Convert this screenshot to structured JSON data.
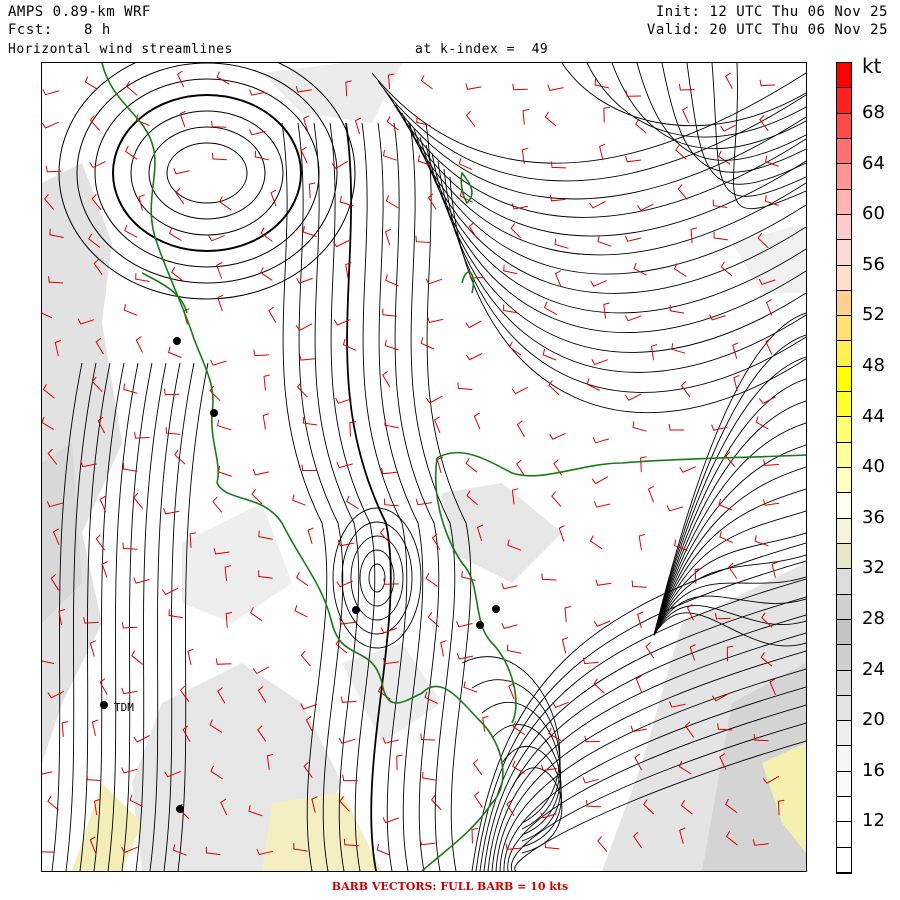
{
  "header": {
    "model": "AMPS 0.89-km WRF",
    "fcst_label": "Fcst:",
    "fcst_value": "8 h",
    "field_title": "Horizontal wind streamlines",
    "level_label": "at k-index =  49",
    "init": "Init: 12 UTC Thu 06 Nov 25",
    "valid": "Valid: 20 UTC Thu 06 Nov 25"
  },
  "map": {
    "station_label": "TDM",
    "station_points": [
      {
        "id": "s1"
      },
      {
        "id": "s2"
      },
      {
        "id": "s3"
      },
      {
        "id": "s4"
      },
      {
        "id": "s5"
      },
      {
        "id": "s6"
      },
      {
        "id": "s7"
      }
    ],
    "colors": {
      "streamline": "#000000",
      "barb": "#dd0000",
      "coastline": "#1a7a1a",
      "terrain_low": "#e6e6e6",
      "terrain_high": "#c8c8c8",
      "terrain_yellow": "#f6f0b0"
    }
  },
  "colorbar": {
    "unit": "kt",
    "labels": [
      "68",
      "64",
      "60",
      "56",
      "52",
      "48",
      "44",
      "40",
      "36",
      "32",
      "28",
      "24",
      "20",
      "16",
      "12"
    ],
    "colors": [
      "#ff0000",
      "#ff2222",
      "#ff4a4a",
      "#ff7070",
      "#ff9696",
      "#ffb4b4",
      "#ffcccc",
      "#ffd8d8",
      "#ffe0c8",
      "#ffd090",
      "#ffe070",
      "#fff050",
      "#ffff00",
      "#ffff30",
      "#ffff70",
      "#ffff9a",
      "#ffffc0",
      "#fffff0",
      "#f4f4d8",
      "#e8e8c8",
      "#dcdcdc",
      "#d0d0d0",
      "#c4c4c4",
      "#cfcfcf",
      "#dadada",
      "#e4e4e4",
      "#eeeeee",
      "#f6f6f6",
      "#fafafa",
      "#ffffff",
      "#ffffff",
      "#ffffff"
    ]
  },
  "footer": "BARB VECTORS:  FULL BARB = 10 kts"
}
